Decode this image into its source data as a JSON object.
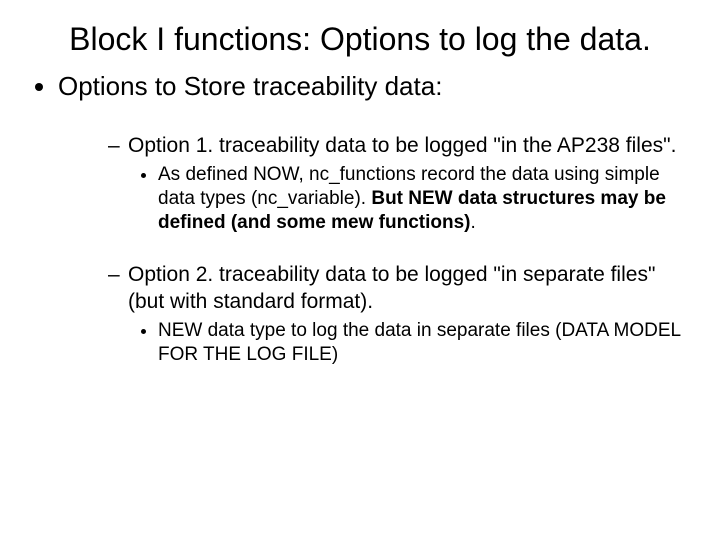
{
  "title": "Block I functions: Options to log the data.",
  "main_bullet": "Options to Store traceability data:",
  "options": [
    {
      "heading": "Option 1. traceability data to be logged \"in the AP238 files\".",
      "detail_pre": "As defined NOW, nc_functions record the data using simple data types (nc_variable). ",
      "detail_bold": "But NEW data structures may be defined (and some mew functions)",
      "detail_post": "."
    },
    {
      "heading": "Option 2. traceability data to be logged \"in separate files\" (but with standard format).",
      "detail_pre": "NEW data type to log the data in separate files (DATA MODEL FOR THE LOG FILE)",
      "detail_bold": "",
      "detail_post": ""
    }
  ]
}
